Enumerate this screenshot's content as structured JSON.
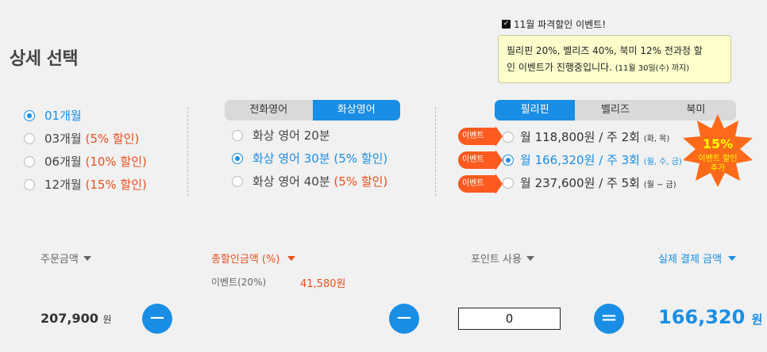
{
  "title": "상세 선택",
  "event": {
    "header": "11월 파격할인 이벤트!",
    "line1": "필리핀 20%, 벨리즈 40%, 북미 12% 전과정 할",
    "line2": "인 이벤트가 진행중입니다.",
    "line2_small": "(11월 30일(수) 까지)"
  },
  "months": [
    {
      "label": "01개월",
      "discount": "",
      "selected": true
    },
    {
      "label": "03개월",
      "discount": "(5% 할인)",
      "selected": false
    },
    {
      "label": "06개월",
      "discount": "(10% 할인)",
      "selected": false
    },
    {
      "label": "12개월",
      "discount": "(15% 할인)",
      "selected": false
    }
  ],
  "course_tabs": [
    "전화영어",
    "화상영어"
  ],
  "courses": [
    {
      "label": "화상 영어 20분",
      "discount": "",
      "selected": false
    },
    {
      "label": "화상 영어 30분",
      "discount": "(5% 할인)",
      "selected": true
    },
    {
      "label": "화상 영어 40분",
      "discount": "(5% 할인)",
      "selected": false
    }
  ],
  "country_tabs": [
    "필리핀",
    "벨리즈",
    "북미"
  ],
  "plans": [
    {
      "badge": "이벤트",
      "price": "월 118,800원",
      "freq": "/ 주 2회",
      "days": "(화, 목)",
      "selected": false
    },
    {
      "badge": "이벤트",
      "price": "월 166,320원",
      "freq": "/ 주 3회",
      "days": "(월, 수, 금)",
      "selected": true
    },
    {
      "badge": "이벤트",
      "price": "월 237,600원",
      "freq": "/ 주 5회",
      "days": "(월 ~ 금)",
      "selected": false
    }
  ],
  "star": {
    "pct": "15%",
    "line1": "이벤트 할인",
    "line2": "추가"
  },
  "summary": {
    "order_label": "주문금액",
    "discount_label": "총할인금액 (%)",
    "point_label": "포인트 사용",
    "final_label": "실제 결제 금액",
    "event_label": "이벤트(20%)",
    "event_amount": "41,580원",
    "order_amount": "207,900",
    "won": "원",
    "point_value": "0",
    "final_amount": "166,320",
    "final_won": "원",
    "minus": "−",
    "equals": "="
  },
  "colors": {
    "accent": "#1a8ee5",
    "discount": "#e8501e",
    "badge": "#ff5a1f",
    "star": "#ff6a1a"
  }
}
